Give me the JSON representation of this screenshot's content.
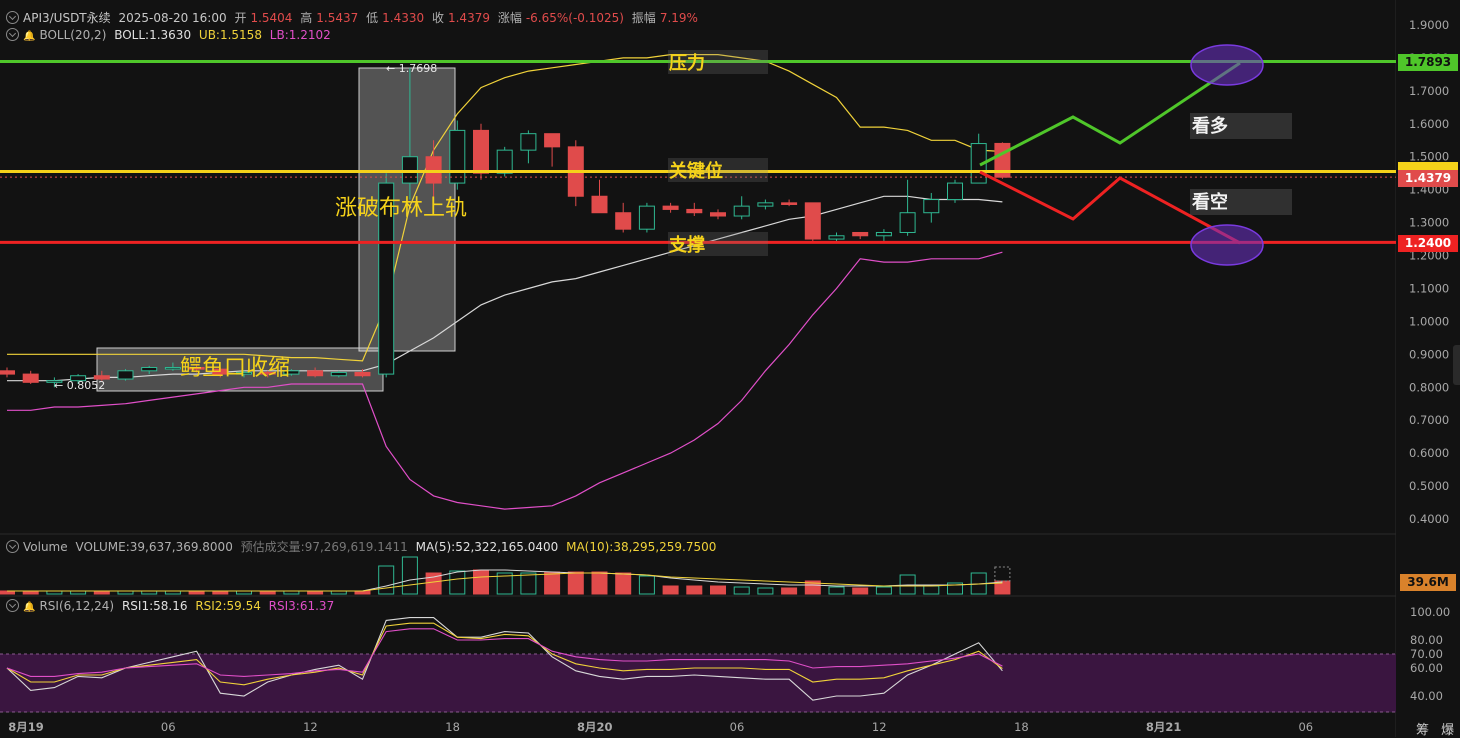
{
  "header": {
    "main": {
      "pair": "API3/USDT永续",
      "datetime": "2025-08-20 16:00",
      "open_label": "开",
      "open": "1.5404",
      "high_label": "高",
      "high": "1.5437",
      "low_label": "低",
      "low": "1.4330",
      "close_label": "收",
      "close": "1.4379",
      "change_label": "涨幅",
      "change": "-6.65%(-0.1025)",
      "amp_label": "振幅",
      "amp": "7.19%"
    },
    "boll": {
      "name": "BOLL(20,2)",
      "boll": "BOLL:1.3630",
      "ub": "UB:1.5158",
      "lb": "LB:1.2102"
    },
    "volume": {
      "name": "Volume",
      "vol": "VOLUME:39,637,369.8000",
      "est": "预估成交量:97,269,619.1411",
      "ma5": "MA(5):52,322,165.0400",
      "ma10": "MA(10):38,295,259.7500"
    },
    "rsi": {
      "name": "RSI(6,12,24)",
      "r1": "RSI1:58.16",
      "r2": "RSI2:59.54",
      "r3": "RSI3:61.37"
    }
  },
  "price_tags": {
    "resistance": "1.7893",
    "key": "1.4379",
    "support": "1.2400",
    "volume": "39.6M"
  },
  "corner": {
    "left": "筹",
    "right": "爆"
  },
  "colors": {
    "up": "#2fb892",
    "down": "#e04b4b",
    "ub": "#f0d23a",
    "mid": "#d8d8d8",
    "lb": "#e04fc8",
    "resistance": "#4fc62a",
    "key": "#f5d21a",
    "support": "#ee2222",
    "rsi_band": "#3a1540",
    "annotation_text": "#f5d21a"
  },
  "chart_data": [
    {
      "type": "candlestick",
      "title": "API3/USDT永续",
      "y_ticks": [
        "1.9000",
        "1.8000",
        "1.7000",
        "1.6000",
        "1.5000",
        "1.4000",
        "1.3000",
        "1.2000",
        "1.1000",
        "1.0000",
        "0.9000",
        "0.8000",
        "0.7000",
        "0.6000",
        "0.5000",
        "0.4000"
      ],
      "x_ticks": [
        {
          "label": "8月19",
          "i": 0
        },
        {
          "label": "06",
          "i": 6
        },
        {
          "label": "12",
          "i": 12
        },
        {
          "label": "18",
          "i": 18
        },
        {
          "label": "8月20",
          "i": 24
        },
        {
          "label": "06",
          "i": 30
        },
        {
          "label": "12",
          "i": 36
        },
        {
          "label": "18",
          "i": 42
        },
        {
          "label": "8月21",
          "i": 48
        },
        {
          "label": "06",
          "i": 54
        }
      ],
      "candles": [
        [
          0.85,
          0.86,
          0.83,
          0.84
        ],
        [
          0.84,
          0.85,
          0.81,
          0.815
        ],
        [
          0.815,
          0.83,
          0.8,
          0.82
        ],
        [
          0.82,
          0.84,
          0.81,
          0.835
        ],
        [
          0.835,
          0.85,
          0.82,
          0.825
        ],
        [
          0.825,
          0.855,
          0.82,
          0.85
        ],
        [
          0.85,
          0.865,
          0.84,
          0.86
        ],
        [
          0.86,
          0.875,
          0.85,
          0.86
        ],
        [
          0.86,
          0.87,
          0.845,
          0.855
        ],
        [
          0.855,
          0.86,
          0.83,
          0.84
        ],
        [
          0.84,
          0.85,
          0.83,
          0.845
        ],
        [
          0.845,
          0.85,
          0.83,
          0.84
        ],
        [
          0.84,
          0.855,
          0.835,
          0.85
        ],
        [
          0.85,
          0.86,
          0.83,
          0.835
        ],
        [
          0.835,
          0.85,
          0.83,
          0.845
        ],
        [
          0.845,
          0.855,
          0.83,
          0.835
        ],
        [
          0.84,
          1.45,
          0.83,
          1.42
        ],
        [
          1.42,
          1.77,
          1.37,
          1.5
        ],
        [
          1.5,
          1.55,
          1.35,
          1.42
        ],
        [
          1.42,
          1.61,
          1.4,
          1.58
        ],
        [
          1.58,
          1.6,
          1.43,
          1.45
        ],
        [
          1.45,
          1.53,
          1.44,
          1.52
        ],
        [
          1.52,
          1.58,
          1.48,
          1.57
        ],
        [
          1.57,
          1.57,
          1.47,
          1.53
        ],
        [
          1.53,
          1.55,
          1.35,
          1.38
        ],
        [
          1.38,
          1.43,
          1.33,
          1.33
        ],
        [
          1.33,
          1.36,
          1.27,
          1.28
        ],
        [
          1.28,
          1.36,
          1.27,
          1.35
        ],
        [
          1.35,
          1.36,
          1.33,
          1.34
        ],
        [
          1.34,
          1.36,
          1.32,
          1.33
        ],
        [
          1.33,
          1.34,
          1.31,
          1.32
        ],
        [
          1.32,
          1.38,
          1.31,
          1.35
        ],
        [
          1.35,
          1.37,
          1.34,
          1.36
        ],
        [
          1.36,
          1.37,
          1.35,
          1.355
        ],
        [
          1.36,
          1.36,
          1.24,
          1.25
        ],
        [
          1.25,
          1.27,
          1.24,
          1.26
        ],
        [
          1.27,
          1.27,
          1.25,
          1.26
        ],
        [
          1.26,
          1.28,
          1.24,
          1.27
        ],
        [
          1.27,
          1.43,
          1.26,
          1.33
        ],
        [
          1.33,
          1.39,
          1.3,
          1.37
        ],
        [
          1.37,
          1.43,
          1.36,
          1.42
        ],
        [
          1.42,
          1.57,
          1.42,
          1.54
        ],
        [
          1.5404,
          1.5437,
          1.433,
          1.4379
        ]
      ],
      "series": [
        {
          "name": "UB",
          "values": [
            0.9,
            0.9,
            0.9,
            0.9,
            0.9,
            0.9,
            0.9,
            0.9,
            0.9,
            0.9,
            0.9,
            0.895,
            0.89,
            0.89,
            0.885,
            0.88,
            1.05,
            1.35,
            1.52,
            1.63,
            1.71,
            1.74,
            1.76,
            1.77,
            1.78,
            1.79,
            1.8,
            1.8,
            1.81,
            1.81,
            1.81,
            1.8,
            1.79,
            1.76,
            1.72,
            1.68,
            1.59,
            1.59,
            1.58,
            1.55,
            1.55,
            1.52,
            1.5158
          ]
        },
        {
          "name": "BOLL",
          "values": [
            0.82,
            0.82,
            0.82,
            0.825,
            0.83,
            0.83,
            0.835,
            0.84,
            0.84,
            0.845,
            0.85,
            0.85,
            0.85,
            0.85,
            0.85,
            0.85,
            0.87,
            0.91,
            0.95,
            1.0,
            1.05,
            1.08,
            1.1,
            1.12,
            1.13,
            1.15,
            1.17,
            1.19,
            1.21,
            1.23,
            1.25,
            1.27,
            1.29,
            1.31,
            1.32,
            1.34,
            1.36,
            1.38,
            1.38,
            1.37,
            1.37,
            1.37,
            1.363
          ]
        },
        {
          "name": "LB",
          "values": [
            0.73,
            0.73,
            0.74,
            0.74,
            0.745,
            0.75,
            0.76,
            0.77,
            0.78,
            0.79,
            0.8,
            0.8,
            0.81,
            0.81,
            0.81,
            0.81,
            0.62,
            0.52,
            0.47,
            0.45,
            0.44,
            0.43,
            0.435,
            0.44,
            0.47,
            0.51,
            0.54,
            0.57,
            0.6,
            0.64,
            0.69,
            0.76,
            0.85,
            0.93,
            1.02,
            1.1,
            1.19,
            1.18,
            1.18,
            1.19,
            1.19,
            1.19,
            1.2102
          ]
        }
      ],
      "levels": [
        {
          "name": "压力",
          "value": 1.7893
        },
        {
          "name": "关键位",
          "value": 1.455
        },
        {
          "name": "支撑",
          "value": 1.24
        }
      ],
      "annotations": [
        "涨破布林上轨",
        "鳄鱼口收缩",
        "看多",
        "看空",
        "1.7698",
        "0.8052"
      ]
    },
    {
      "type": "bar",
      "title": "Volume",
      "values": [
        3,
        3,
        3,
        3,
        3,
        3,
        3,
        3,
        3,
        3,
        3,
        3,
        3,
        3,
        3,
        3,
        28,
        37,
        21,
        23,
        24,
        21,
        21,
        22,
        22,
        22,
        21,
        18,
        8,
        8,
        8,
        7,
        6,
        6,
        13,
        7,
        6,
        7,
        19,
        8,
        11,
        21,
        13
      ],
      "series": [
        {
          "name": "MA(5)",
          "values": [
            3,
            3,
            3,
            3,
            3,
            3,
            3,
            3,
            3,
            3,
            3,
            3,
            3,
            3,
            3,
            3,
            8,
            14,
            17,
            22,
            24,
            24,
            23,
            22,
            21,
            21,
            20,
            19,
            16,
            14,
            12,
            11,
            10,
            9,
            9,
            8,
            8,
            8,
            9,
            9,
            9,
            10,
            12
          ]
        },
        {
          "name": "MA(10)",
          "values": [
            3,
            3,
            3,
            3,
            3,
            3,
            3,
            3,
            3,
            3,
            3,
            3,
            3,
            3,
            3,
            3,
            6,
            9,
            12,
            15,
            17,
            18,
            19,
            20,
            21,
            21,
            20,
            19,
            17,
            16,
            15,
            14,
            13,
            12,
            11,
            10,
            9,
            8,
            8,
            8,
            9,
            10,
            11
          ]
        }
      ]
    },
    {
      "type": "line",
      "title": "RSI(6,12,24)",
      "y_ticks": [
        "100.00",
        "80.00",
        "70.00",
        "60.00",
        "40.00"
      ],
      "series": [
        {
          "name": "RSI1",
          "values": [
            60,
            44,
            46,
            54,
            53,
            60,
            64,
            68,
            72,
            42,
            40,
            50,
            55,
            59,
            62,
            52,
            94,
            96,
            96,
            82,
            82,
            86,
            85,
            68,
            58,
            54,
            52,
            54,
            54,
            55,
            54,
            53,
            52,
            52,
            37,
            40,
            40,
            42,
            55,
            62,
            70,
            78,
            58
          ]
        },
        {
          "name": "RSI2",
          "values": [
            60,
            50,
            50,
            55,
            55,
            60,
            62,
            64,
            66,
            50,
            48,
            52,
            55,
            57,
            60,
            55,
            90,
            92,
            92,
            82,
            81,
            84,
            83,
            70,
            63,
            60,
            58,
            59,
            59,
            60,
            60,
            60,
            59,
            59,
            50,
            52,
            52,
            53,
            58,
            62,
            66,
            72,
            59.54
          ]
        },
        {
          "name": "RSI3",
          "values": [
            60,
            54,
            54,
            56,
            57,
            60,
            61,
            62,
            63,
            55,
            54,
            55,
            56,
            58,
            59,
            57,
            86,
            88,
            88,
            80,
            80,
            81,
            81,
            72,
            68,
            66,
            65,
            65,
            66,
            66,
            66,
            66,
            66,
            65,
            60,
            61,
            61,
            62,
            63,
            65,
            67,
            70,
            61.37
          ]
        }
      ]
    }
  ]
}
